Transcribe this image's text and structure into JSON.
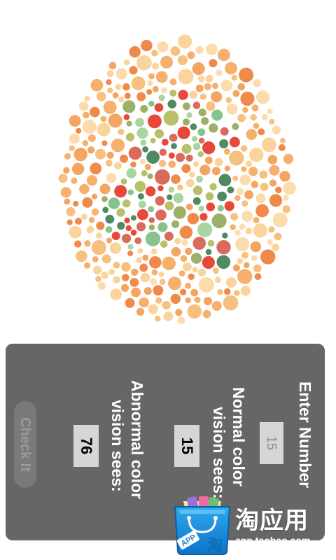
{
  "plate": {
    "description_icon": "ishihara-color-plate",
    "colors": {
      "background_dots": [
        "#f4a562",
        "#f7c07e",
        "#fbd39c",
        "#f08a4b",
        "#f6b06c",
        "#fcdcad"
      ],
      "figure_dots": [
        "#4f8a62",
        "#87c28f",
        "#a9d5a0",
        "#b7c06a",
        "#9db06a",
        "#e8483b",
        "#d96b5c"
      ]
    }
  },
  "form": {
    "enter_label": "Enter Number",
    "input_value": "15",
    "normal_label_line1": "Normal color",
    "normal_label_line2": "vision sees:",
    "normal_value": "15",
    "abnormal_label_line1": "Abnormal color",
    "abnormal_label_line2": "vision sees:",
    "abnormal_value": "76",
    "check_button": "Check It"
  },
  "ad": {
    "icon": "shopping-bag-app-icon",
    "badge": "APP",
    "title": "淘应用",
    "url": "app.taobao.com"
  }
}
